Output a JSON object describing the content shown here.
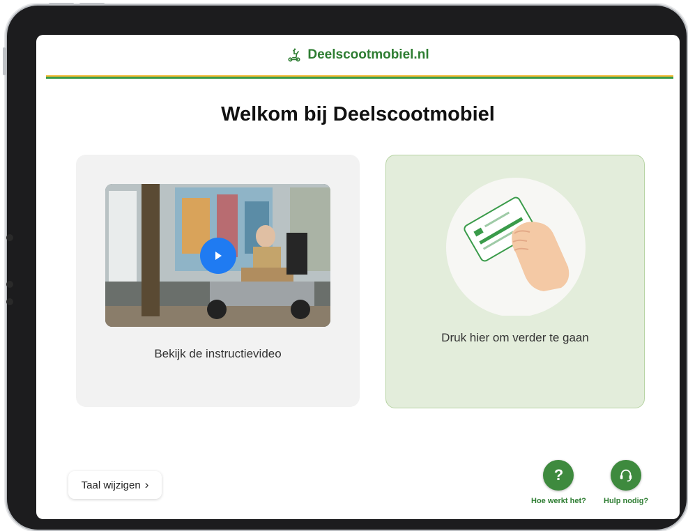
{
  "header": {
    "brand": "Deelscootmobiel.nl",
    "brand_icon": "scooter-icon"
  },
  "main": {
    "title": "Welkom bij Deelscootmobiel",
    "video_card": {
      "label": "Bekijk de instructievideo",
      "play_icon": "play-icon"
    },
    "start_card": {
      "label": "Druk hier om verder te gaan",
      "illustration": "card-in-hand-illustration"
    }
  },
  "footer": {
    "language_button": "Taal wijzigen",
    "language_chevron": "›",
    "how_it_works": {
      "label": "Hoe werkt het?",
      "icon_text": "?"
    },
    "need_help": {
      "label": "Hulp nodig?",
      "icon": "headset-icon"
    }
  },
  "colors": {
    "brand_green": "#2e7d32",
    "accent_yellow": "#f5b932",
    "play_blue": "#1f7bf2",
    "card_green": "#e3eddb"
  }
}
